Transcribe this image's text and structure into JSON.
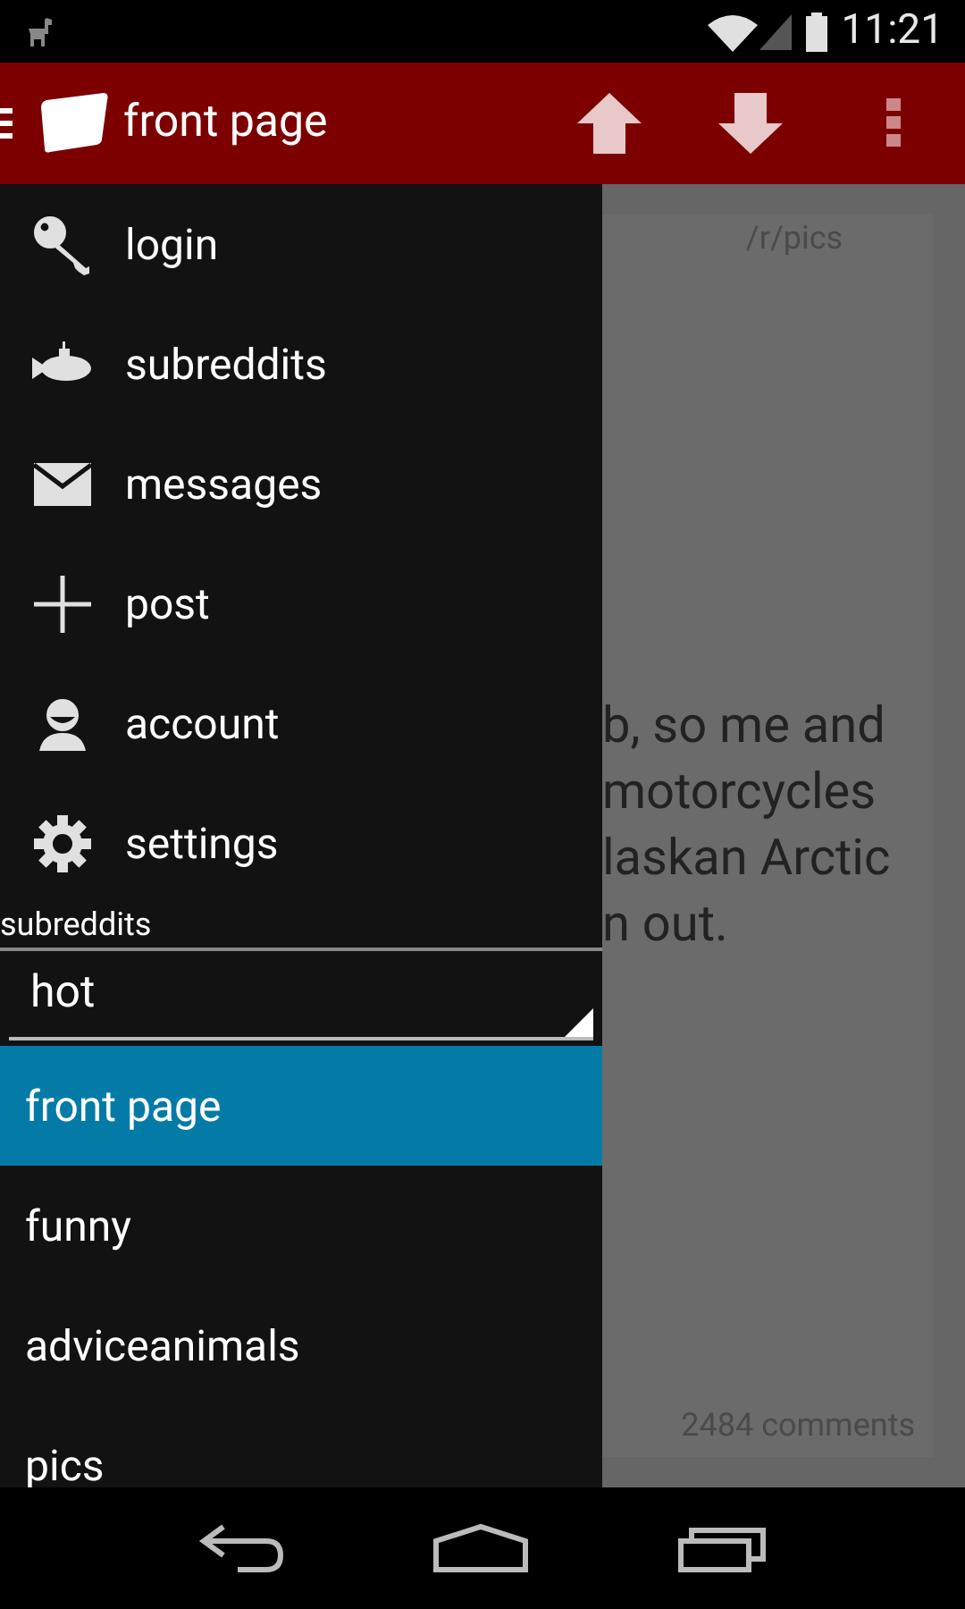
{
  "status_bar": {
    "time": "11:21"
  },
  "app_bar": {
    "title": "front page"
  },
  "background_post": {
    "subreddit": "/r/pics",
    "text_lines": [
      "b, so me and",
      "motorcycles",
      "laskan Arctic",
      "n out."
    ],
    "comments": "2484 comments"
  },
  "drawer": {
    "menu": [
      {
        "label": "login",
        "kind": "key"
      },
      {
        "label": "subreddits",
        "kind": "submarine"
      },
      {
        "label": "messages",
        "kind": "mail"
      },
      {
        "label": "post",
        "kind": "plus"
      },
      {
        "label": "account",
        "kind": "person"
      },
      {
        "label": "settings",
        "kind": "gear"
      }
    ],
    "section_label": "subreddits",
    "sort": {
      "value": "hot"
    },
    "subreddits": [
      {
        "label": "front page",
        "selected": true
      },
      {
        "label": "funny",
        "selected": false
      },
      {
        "label": "adviceanimals",
        "selected": false
      },
      {
        "label": "pics",
        "selected": false
      }
    ]
  }
}
